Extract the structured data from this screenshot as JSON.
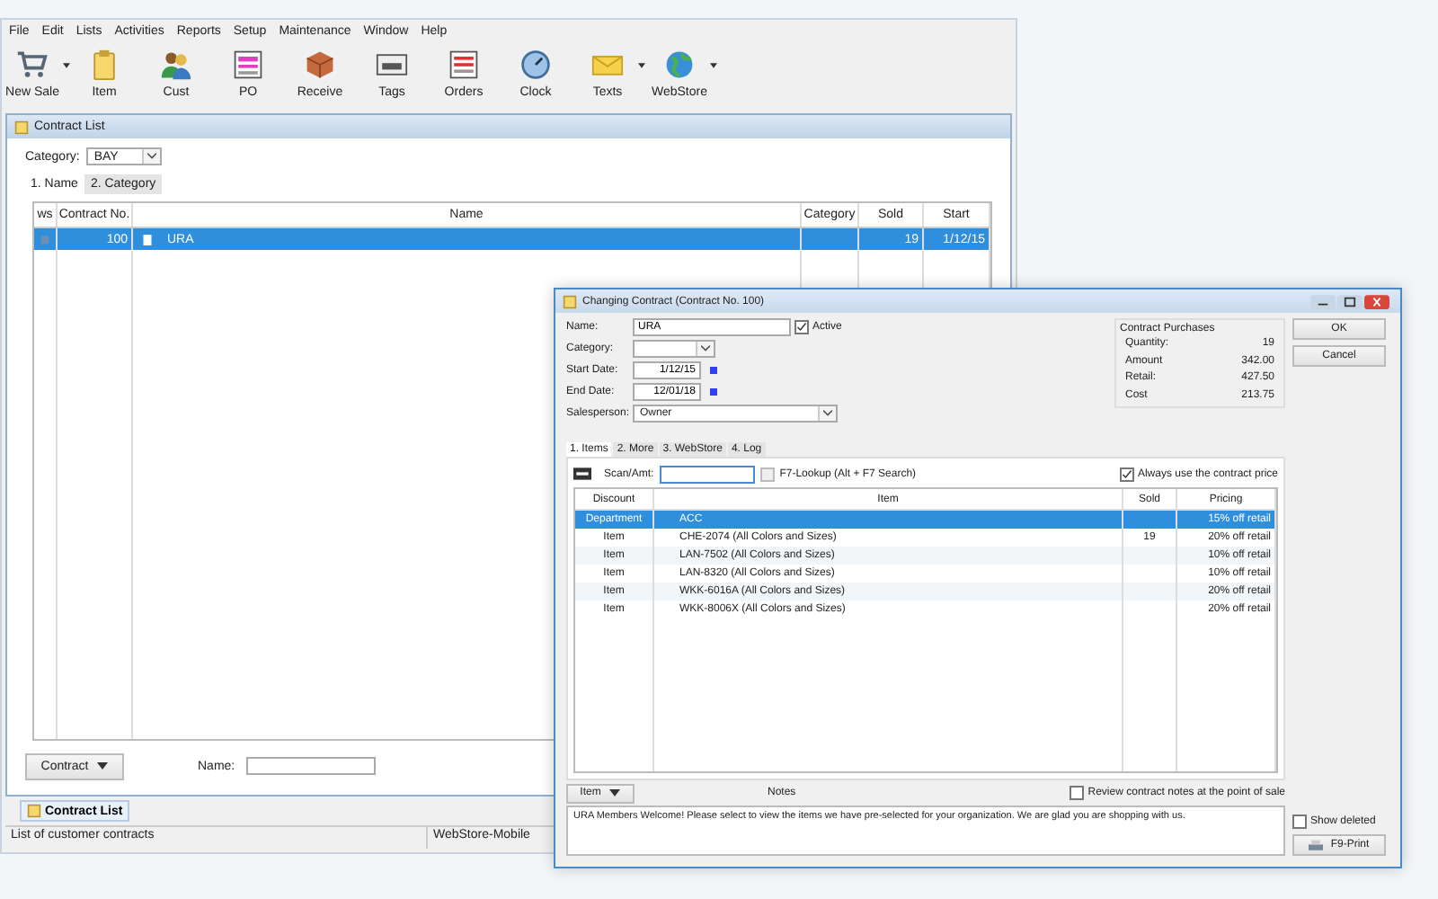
{
  "menu": [
    "File",
    "Edit",
    "Lists",
    "Activities",
    "Reports",
    "Setup",
    "Maintenance",
    "Window",
    "Help"
  ],
  "toolbar": [
    {
      "label": "New Sale",
      "kind": "cart",
      "dropdown": true
    },
    {
      "label": "Item",
      "kind": "clipboard",
      "dropdown": false
    },
    {
      "label": "Cust",
      "kind": "people",
      "dropdown": false
    },
    {
      "label": "PO",
      "kind": "form",
      "dropdown": false
    },
    {
      "label": "Receive",
      "kind": "box",
      "dropdown": false
    },
    {
      "label": "Tags",
      "kind": "tags",
      "dropdown": false
    },
    {
      "label": "Orders",
      "kind": "orders",
      "dropdown": false
    },
    {
      "label": "Clock",
      "kind": "clock",
      "dropdown": false
    },
    {
      "label": "Texts",
      "kind": "envelope",
      "dropdown": true
    },
    {
      "label": "WebStore",
      "kind": "globe",
      "dropdown": true
    }
  ],
  "contract_list": {
    "title": "Contract List",
    "category_label": "Category:",
    "category": "BAY",
    "tabs": [
      {
        "label": "1. Name",
        "selected": true
      },
      {
        "label": "2. Category",
        "selected": false
      }
    ],
    "columns": [
      "ws",
      "Contract No.",
      "Name",
      "Category",
      "Sold",
      "Start"
    ],
    "rows": [
      {
        "contract_no": "100",
        "name": "URA",
        "sold": "19",
        "start": "1/12/15",
        "selected": true
      }
    ],
    "contract_button": "Contract",
    "name_label": "Name:"
  },
  "taskbar": [
    "Contract List"
  ],
  "status_bar": [
    "List of customer contracts",
    "WebStore-Mobile"
  ],
  "dialog": {
    "title": "Changing Contract  (Contract No. 100)",
    "name_label": "Name:",
    "name": "URA",
    "active": {
      "label": "Active",
      "checked": true
    },
    "category_label": "Category:",
    "start_label": "Start Date:",
    "start": "1/12/15",
    "end_label": "End Date:",
    "end": "12/01/18",
    "salesperson_label": "Salesperson:",
    "salesperson": "Owner",
    "purchases": {
      "title": "Contract Purchases",
      "rows": [
        {
          "label": "Quantity:",
          "value": "19"
        },
        {
          "label": "Amount",
          "value": "342.00"
        },
        {
          "label": "Retail:",
          "value": "427.50"
        },
        {
          "label": "Cost",
          "value": "213.75"
        }
      ]
    },
    "buttons": [
      "OK",
      "Cancel"
    ],
    "tabs": [
      {
        "label": "1. Items",
        "selected": true
      },
      {
        "label": "2. More",
        "selected": false
      },
      {
        "label": "3. WebStore",
        "selected": false
      },
      {
        "label": "4. Log",
        "selected": false
      }
    ],
    "scan_label": "Scan/Amt:",
    "lookup": "F7-Lookup  (Alt + F7 Search)",
    "always": {
      "label": "Always use the contract price",
      "checked": true
    },
    "columns": [
      "Discount",
      "Item",
      "Sold",
      "Pricing"
    ],
    "rows": [
      {
        "discount": "Department",
        "item": "ACC",
        "sold": "",
        "pricing": "15% off retail",
        "selected": true
      },
      {
        "discount": "Item",
        "item": "CHE-2074  (All Colors and Sizes)",
        "sold": "19",
        "pricing": "20% off retail",
        "selected": false
      },
      {
        "discount": "Item",
        "item": "LAN-7502  (All Colors and Sizes)",
        "sold": "",
        "pricing": "10% off retail",
        "selected": false
      },
      {
        "discount": "Item",
        "item": "LAN-8320  (All Colors and Sizes)",
        "sold": "",
        "pricing": "10% off retail",
        "selected": false
      },
      {
        "discount": "Item",
        "item": "WKK-6016A  (All Colors and Sizes)",
        "sold": "",
        "pricing": "20% off retail",
        "selected": false
      },
      {
        "discount": "Item",
        "item": "WKK-8006X  (All Colors and Sizes)",
        "sold": "",
        "pricing": "20% off retail",
        "selected": false
      }
    ],
    "item_button": "Item",
    "review": {
      "label": "Review contract notes at the point of sale",
      "checked": false
    },
    "notes_label": "Notes",
    "notes": "URA Members Welcome! Please select to view the items we have pre-selected for your organization. We are glad you are shopping with us.",
    "show_deleted": {
      "label": "Show deleted",
      "checked": false
    },
    "print_button": "F9-Print"
  }
}
